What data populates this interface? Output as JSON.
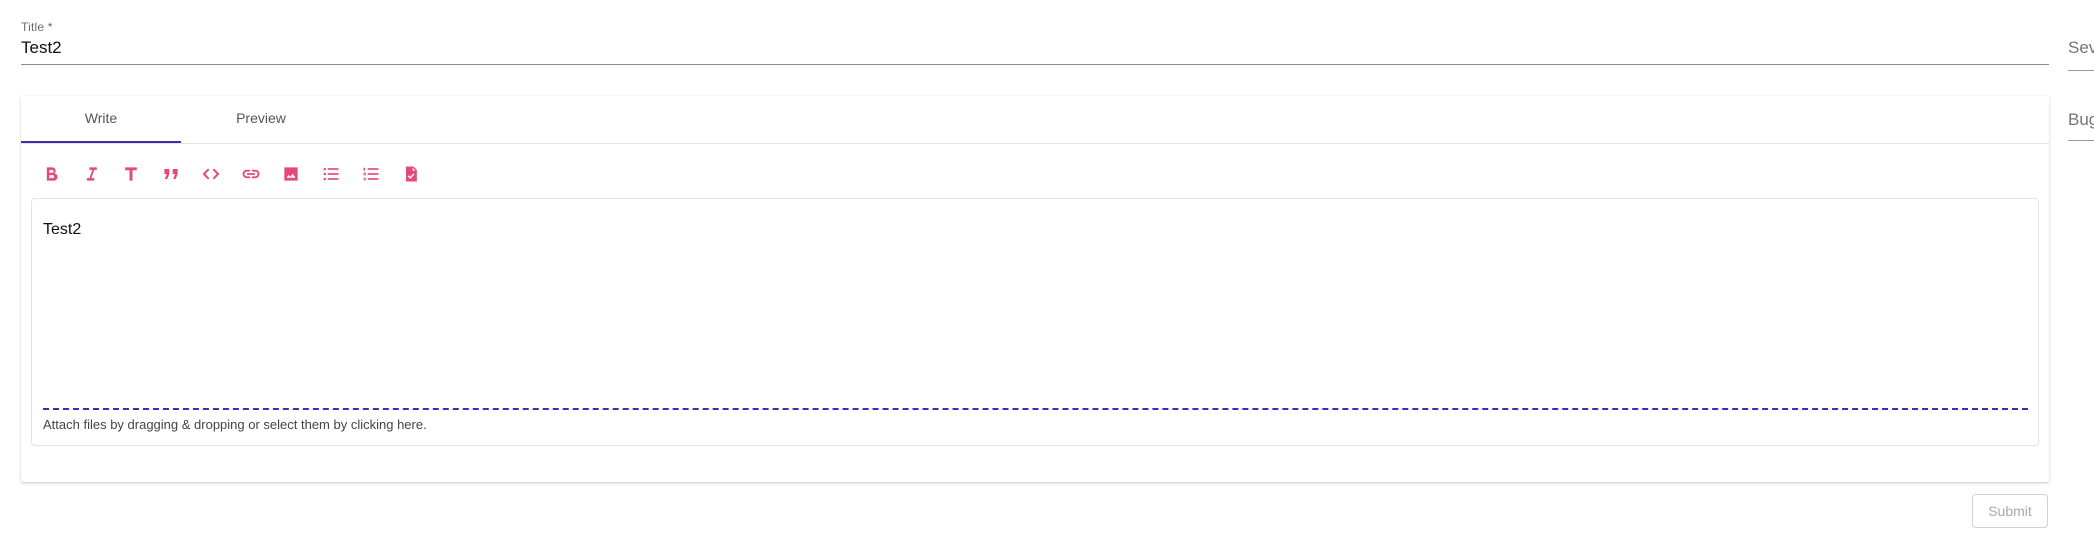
{
  "form": {
    "title_label": "Title *",
    "title_value": "Test2",
    "side_fields": {
      "severity_partial": "Sev",
      "bug_partial": "Bug"
    }
  },
  "editor": {
    "tabs": [
      {
        "label": "Write",
        "active": true
      },
      {
        "label": "Preview",
        "active": false
      }
    ],
    "toolbar_icons": [
      "bold-icon",
      "italic-icon",
      "header-icon",
      "quote-icon",
      "code-icon",
      "link-icon",
      "image-icon",
      "unordered-list-icon",
      "ordered-list-icon",
      "task-list-icon"
    ],
    "content": "Test2",
    "attach_hint": "Attach files by dragging & dropping or select them by clicking here."
  },
  "actions": {
    "submit_label": "Submit"
  },
  "colors": {
    "icon_pink": "#e4497e",
    "accent_indigo": "#3f2bb5"
  }
}
